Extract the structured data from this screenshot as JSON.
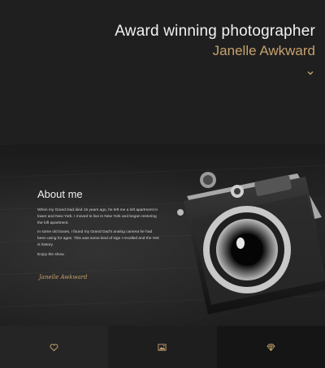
{
  "hero": {
    "title": "Award winning photographer",
    "name": "Janelle Awkward",
    "scroll_icon": "chevron-down-icon"
  },
  "about": {
    "heading": "About me",
    "paragraphs": [
      "When my Grand Dad died 15 years ago, he left me a loft apartment in lower and New York. I moved to live in New York and began restoring the loft apartment.",
      "In some old boxes, I found my Grand Dad's analog camera he had been using for ages. This was some kind of sign I recalled and the rest is history.",
      "Enjoy the show."
    ],
    "signature": "Janelle Awkward"
  },
  "footer": {
    "items": [
      {
        "icon": "heart-icon",
        "bg": "#252525"
      },
      {
        "icon": "image-icon",
        "bg": "#1e1e1e"
      },
      {
        "icon": "diamond-icon",
        "bg": "#151515"
      }
    ]
  },
  "colors": {
    "accent": "#c6a26e",
    "background": "#1d1d1d"
  }
}
